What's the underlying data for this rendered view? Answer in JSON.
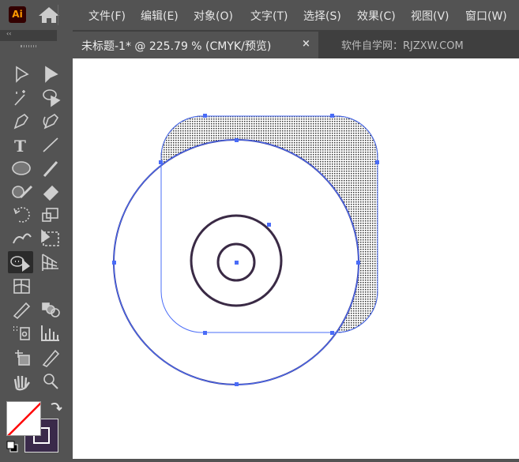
{
  "app": {
    "logo_text": "Ai"
  },
  "menu": [
    "文件(F)",
    "编辑(E)",
    "对象(O)",
    "文字(T)",
    "选择(S)",
    "效果(C)",
    "视图(V)",
    "窗口(W)"
  ],
  "document_tab": {
    "title": "未标题-1* @ 225.79 % (CMYK/预览)",
    "close": "×"
  },
  "watermark": "软件自学网：RJZXW.COM",
  "panel": {
    "collapse": "‹‹"
  },
  "tools": [
    "selection",
    "direct-selection",
    "magic-wand",
    "lasso",
    "pen",
    "curvature",
    "type",
    "line-segment",
    "ellipse",
    "paintbrush",
    "shaper",
    "eraser",
    "rotate",
    "scale",
    "puppet-warp",
    "free-transform",
    "shape-builder",
    "perspective-grid",
    "mesh",
    "gradient",
    "eyedropper",
    "blend",
    "symbol-sprayer",
    "column-graph",
    "artboard",
    "slice",
    "hand",
    "zoom"
  ],
  "active_tool": "shape-builder",
  "colors": {
    "stroke": "#3a2a4a",
    "path_selection": "#4a6cf7",
    "artwork_stroke": "#3a2a45"
  }
}
